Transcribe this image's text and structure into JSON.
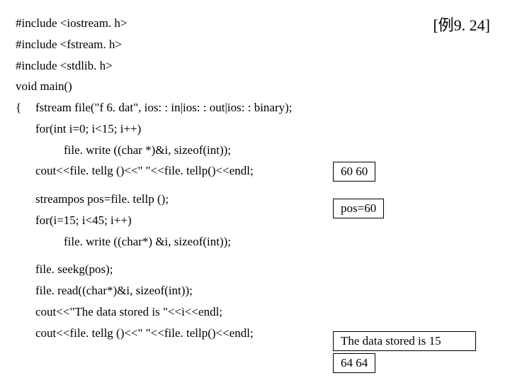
{
  "title": "[例9. 24]",
  "code": {
    "l1": "#include <iostream. h>",
    "l2": "#include <fstream. h>",
    "l3": "#include <stdlib. h>",
    "l4": "void main()",
    "l5_brace": "{",
    "l5": "fstream file(\"f 6. dat\", ios: : in|ios: : out|ios: : binary);",
    "l6": "for(int i=0; i<15; i++)",
    "l7": "file. write ((char *)&i, sizeof(int));",
    "l8": "cout<<file. tellg ()<<\" \"<<file. tellp()<<endl;",
    "l9": "streampos pos=file. tellp ();",
    "l10": "for(i=15; i<45; i++)",
    "l11": "file. write ((char*) &i, sizeof(int));",
    "l12": "file. seekg(pos);",
    "l13": "file. read((char*)&i, sizeof(int));",
    "l14": "cout<<\"The data stored is \"<<i<<endl;",
    "l15": "cout<<file. tellg ()<<\" \"<<file. tellp()<<endl;"
  },
  "boxes": {
    "b1": "60  60",
    "b2": "pos=60",
    "b3": "The data stored is 15",
    "b4": "64   64"
  }
}
